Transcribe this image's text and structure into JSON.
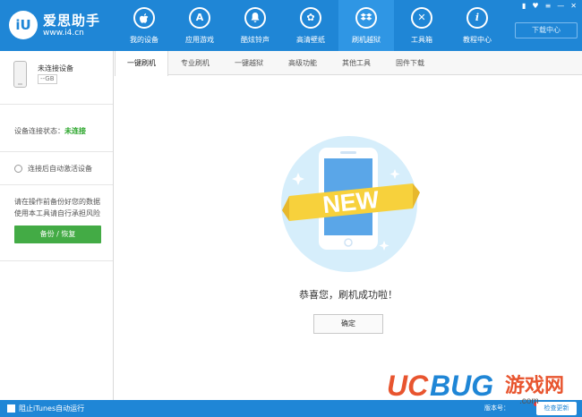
{
  "app": {
    "logo_mark": "iU",
    "name": "爱思助手",
    "url": "www.i4.cn"
  },
  "nav": {
    "items": [
      {
        "label": "我的设备",
        "icon": "apple-icon",
        "glyph": ""
      },
      {
        "label": "应用游戏",
        "icon": "app-store-icon",
        "glyph": "A"
      },
      {
        "label": "酷炫铃声",
        "icon": "bell-icon",
        "glyph": "♪"
      },
      {
        "label": "高清壁纸",
        "icon": "flower-icon",
        "glyph": "✿"
      },
      {
        "label": "刷机越狱",
        "icon": "dropbox-icon",
        "glyph": "❖"
      },
      {
        "label": "工具箱",
        "icon": "tools-icon",
        "glyph": "✕"
      },
      {
        "label": "教程中心",
        "icon": "info-icon",
        "glyph": "i"
      }
    ],
    "active_index": 4
  },
  "window": {
    "download_center": "下载中心",
    "controls": [
      "▮",
      "♥",
      "≡",
      "—",
      "✕"
    ]
  },
  "sidebar": {
    "device_name": "未连接设备",
    "device_capacity": "--GB",
    "status_label": "设备连接状态：",
    "status_value": "未连接",
    "status_color": "#2aa52a",
    "auto_activate": "连接后自动激活设备",
    "warning_line1": "请在操作前备份好您的数据",
    "warning_line2": "使用本工具请自行承担风险",
    "backup_button": "备份 / 恢复",
    "backup_color": "#43ab45"
  },
  "subtabs": {
    "items": [
      "一键刷机",
      "专业刷机",
      "一键越狱",
      "高级功能",
      "其他工具",
      "固件下载"
    ],
    "active_index": 0
  },
  "main": {
    "badge_text": "NEW",
    "success_message": "恭喜您，刷机成功啦！",
    "ok_button": "确定"
  },
  "bottombar": {
    "itunes_label": "阻止iTunes自动运行",
    "version_label": "版本号：",
    "update_button": "检查更新"
  },
  "watermark": {
    "brand_uc": "UC",
    "brand_bug": "BUG",
    "brand_cn": "游戏网",
    "brand_domain": ".com"
  },
  "colors": {
    "primary": "#1f86d6",
    "primary_active": "#2f96e4",
    "badge_yellow": "#f7d13c",
    "illus_circle": "#d6eefb"
  }
}
